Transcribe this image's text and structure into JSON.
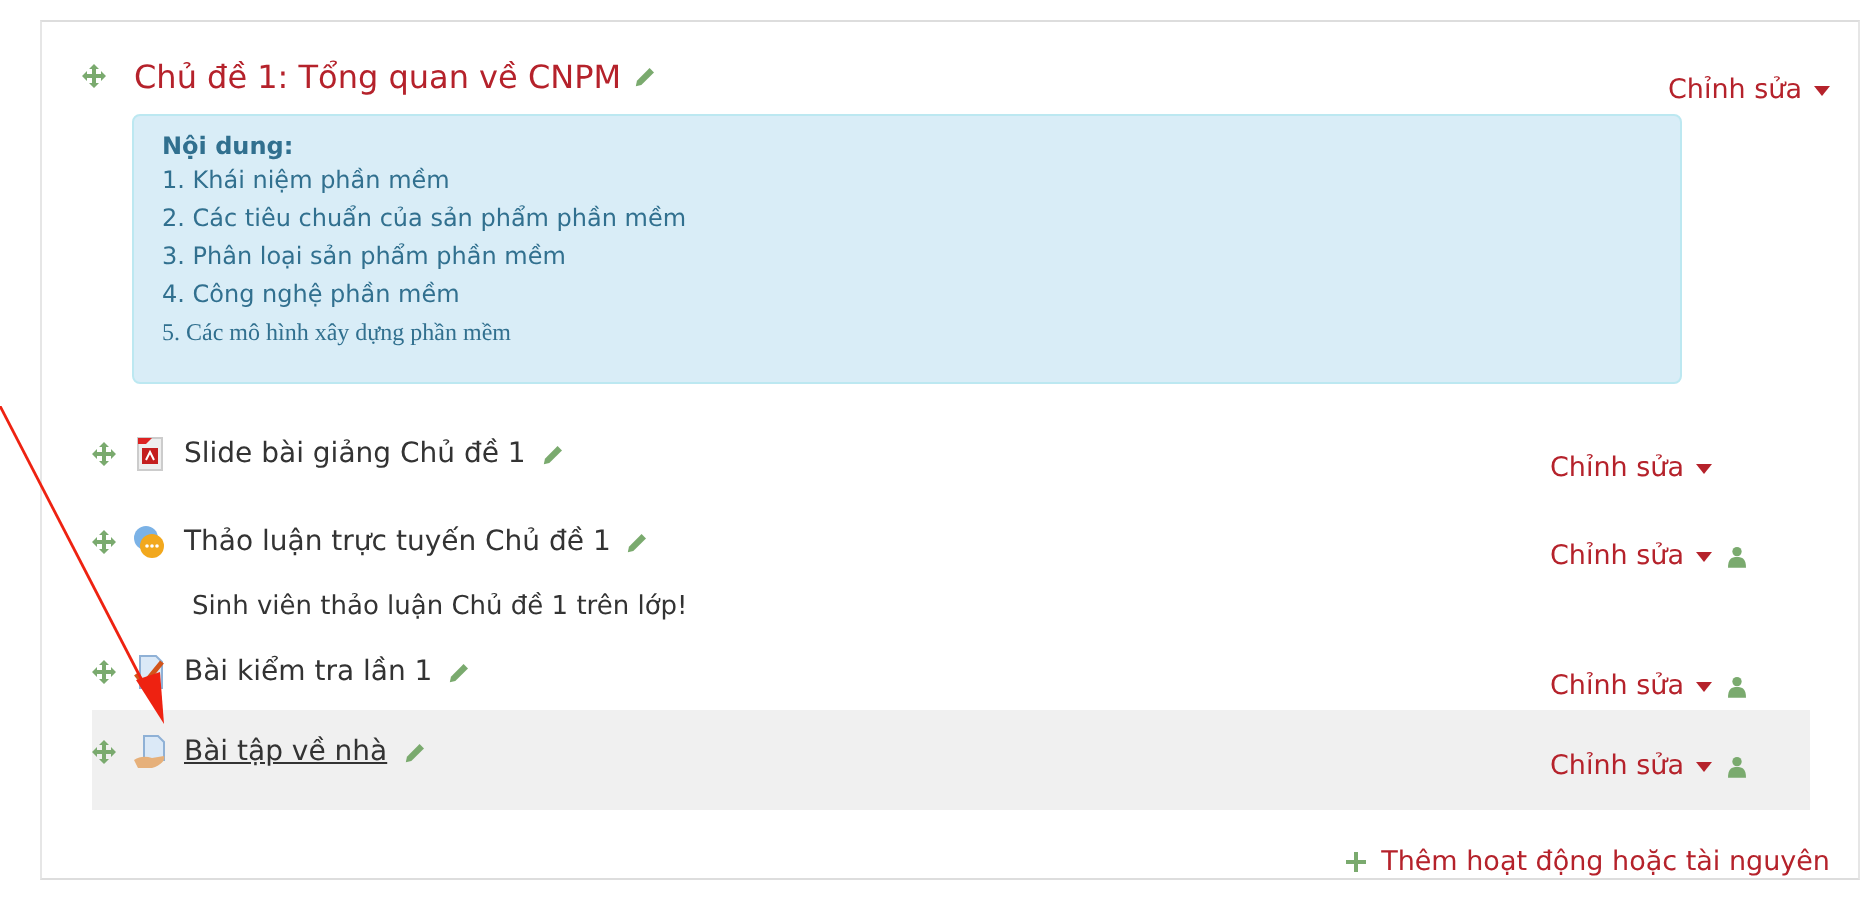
{
  "section": {
    "title": "Chủ đề 1: Tổng quan về CNPM",
    "edit_label": "Chỉnh sửa",
    "summary": {
      "heading": "Nội dung:",
      "lines": [
        "1. Khái niệm phần mềm",
        "2. Các tiêu chuẩn của sản phẩm phần mềm",
        "3. Phân loại sản phẩm phần mềm",
        "4. Công nghệ phần mềm",
        "5. Các mô hình xây dựng phần mềm"
      ]
    }
  },
  "activities": [
    {
      "kind": "file",
      "name": "Slide bài giảng Chủ đề 1",
      "edit_label": "Chỉnh sửa",
      "group_mode": false,
      "highlighted": false
    },
    {
      "kind": "forum",
      "name": "Thảo luận trực tuyến Chủ đề 1",
      "description": "Sinh viên thảo luận Chủ đề 1 trên lớp!",
      "edit_label": "Chỉnh sửa",
      "group_mode": true,
      "highlighted": false
    },
    {
      "kind": "quiz",
      "name": "Bài kiểm tra lần 1",
      "edit_label": "Chỉnh sửa",
      "group_mode": true,
      "highlighted": false
    },
    {
      "kind": "assignment",
      "name": "Bài tập về nhà",
      "edit_label": "Chỉnh sửa",
      "group_mode": true,
      "highlighted": true
    }
  ],
  "add_activity": {
    "label": "Thêm hoạt động hoặc tài nguyên"
  }
}
